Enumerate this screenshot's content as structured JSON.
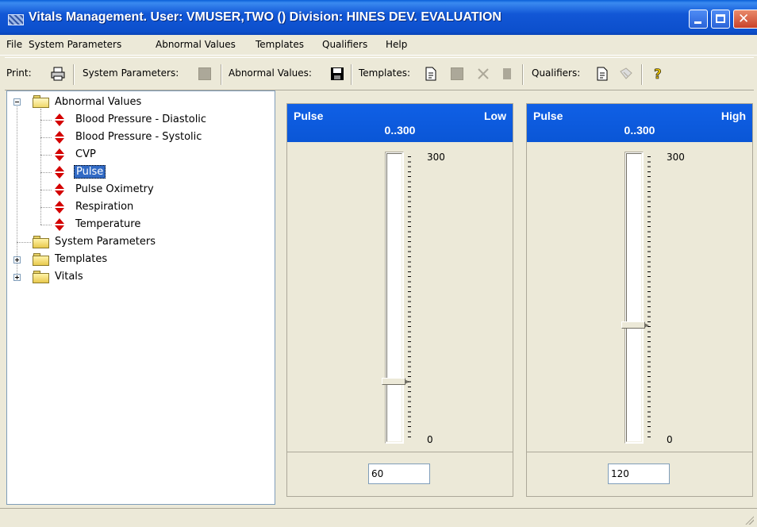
{
  "window": {
    "title": "Vitals Management. User: VMUSER,TWO  () Division: HINES DEV. EVALUATION"
  },
  "menu": [
    "File",
    "System Parameters",
    "Abnormal Values",
    "Templates",
    "Qualifiers",
    "Help"
  ],
  "toolbar": {
    "print_label": "Print:",
    "system_parameters_label": "System Parameters:",
    "abnormal_values_label": "Abnormal Values:",
    "templates_label": "Templates:",
    "qualifiers_label": "Qualifiers:"
  },
  "tree": {
    "abnormal_values": "Abnormal Values",
    "items": [
      "Blood Pressure - Diastolic",
      "Blood Pressure - Systolic",
      "CVP",
      "Pulse",
      "Pulse Oximetry",
      "Respiration",
      "Temperature"
    ],
    "selected_item": "Pulse",
    "system_parameters": "System Parameters",
    "templates": "Templates",
    "vitals": "Vitals"
  },
  "low_panel": {
    "name": "Pulse",
    "level": "Low",
    "range": "0..300",
    "scale_max": "300",
    "scale_min": "0",
    "value": "60",
    "fraction": 0.2
  },
  "high_panel": {
    "name": "Pulse",
    "level": "High",
    "range": "0..300",
    "scale_max": "300",
    "scale_min": "0",
    "value": "120",
    "fraction": 0.4
  }
}
